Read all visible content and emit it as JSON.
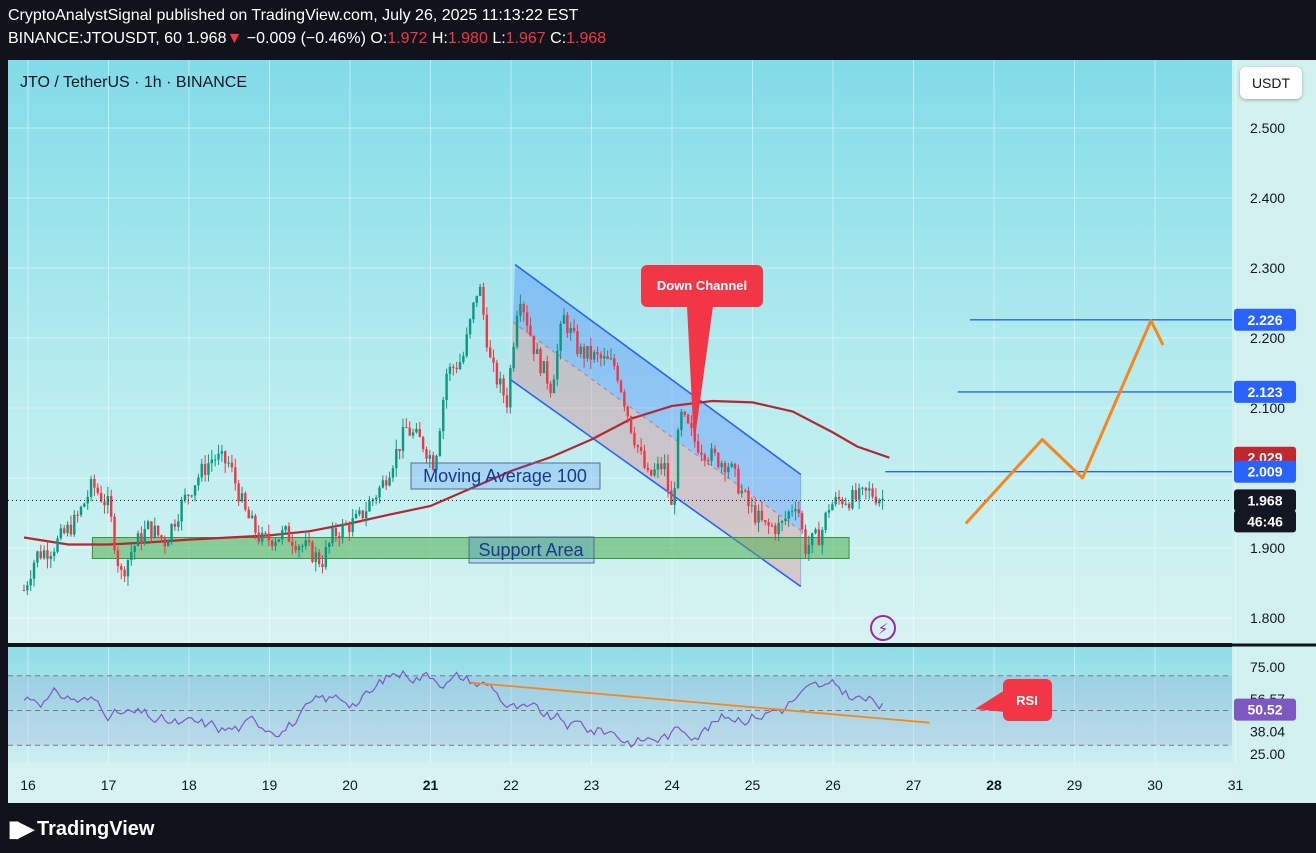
{
  "header": {
    "publisher_line": "CryptoAnalystSignal published on TradingView.com, July 26, 2025 11:13:22 EST",
    "symbol_line_prefix": "BINANCE:JTOUSDT, 60",
    "last": "1.968",
    "change": "−0.009 (−0.46%)",
    "open_label": "O:",
    "open": "1.972",
    "high_label": "H:",
    "high": "1.980",
    "low_label": "L:",
    "low": "1.967",
    "close_label": "C:",
    "close": "1.968"
  },
  "pane": {
    "symbol_title": "JTO / TetherUS · 1h · BINANCE",
    "currency_button": "USDT",
    "price_labels": [
      "2.500",
      "2.400",
      "2.300",
      "2.200",
      "2.100",
      "1.900",
      "1.800"
    ],
    "badges": [
      {
        "text": "2.226",
        "color": "#2962ff"
      },
      {
        "text": "2.123",
        "color": "#2962ff"
      },
      {
        "text": "2.029",
        "color": "#c2272d"
      },
      {
        "text": "2.009",
        "color": "#2962ff"
      },
      {
        "text": "1.968",
        "color": "#131722"
      },
      {
        "text": "46:46",
        "color": "#131722"
      }
    ],
    "annotations": {
      "down_channel": "Down Channel",
      "moving_average": "Moving Average 100",
      "support_area": "Support Area",
      "rsi_callout": "RSI"
    }
  },
  "rsi_pane": {
    "labels": [
      "75.00",
      "56.57",
      "38.04",
      "25.00"
    ],
    "value_badge": "50.52"
  },
  "x_axis": {
    "ticks": [
      "16",
      "17",
      "18",
      "19",
      "20",
      "21",
      "22",
      "23",
      "24",
      "25",
      "26",
      "27",
      "28",
      "29",
      "30",
      "31"
    ]
  },
  "footer": {
    "brand": "TradingView"
  },
  "chart_data": {
    "type": "candlestick",
    "title": "JTO / TetherUS · 1h · BINANCE",
    "x_ticks": [
      "16",
      "17",
      "18",
      "19",
      "20",
      "21",
      "22",
      "23",
      "24",
      "25",
      "26",
      "27",
      "28",
      "29",
      "30",
      "31"
    ],
    "ylim": [
      1.76,
      2.58
    ],
    "price_path": [
      {
        "x": 15.95,
        "y": 1.84
      },
      {
        "x": 16.1,
        "y": 1.89
      },
      {
        "x": 16.3,
        "y": 1.9
      },
      {
        "x": 16.6,
        "y": 1.94
      },
      {
        "x": 16.8,
        "y": 1.99
      },
      {
        "x": 17.0,
        "y": 1.96
      },
      {
        "x": 17.15,
        "y": 1.86
      },
      {
        "x": 17.3,
        "y": 1.9
      },
      {
        "x": 17.5,
        "y": 1.93
      },
      {
        "x": 17.7,
        "y": 1.91
      },
      {
        "x": 17.9,
        "y": 1.96
      },
      {
        "x": 18.1,
        "y": 2.0
      },
      {
        "x": 18.3,
        "y": 2.03
      },
      {
        "x": 18.5,
        "y": 2.02
      },
      {
        "x": 18.7,
        "y": 1.95
      },
      {
        "x": 18.9,
        "y": 1.91
      },
      {
        "x": 19.2,
        "y": 1.92
      },
      {
        "x": 19.45,
        "y": 1.9
      },
      {
        "x": 19.65,
        "y": 1.88
      },
      {
        "x": 19.8,
        "y": 1.92
      },
      {
        "x": 20.1,
        "y": 1.94
      },
      {
        "x": 20.4,
        "y": 1.99
      },
      {
        "x": 20.7,
        "y": 2.07
      },
      {
        "x": 20.9,
        "y": 2.05
      },
      {
        "x": 21.05,
        "y": 2.02
      },
      {
        "x": 21.2,
        "y": 2.15
      },
      {
        "x": 21.4,
        "y": 2.17
      },
      {
        "x": 21.6,
        "y": 2.28
      },
      {
        "x": 21.75,
        "y": 2.16
      },
      {
        "x": 21.95,
        "y": 2.11
      },
      {
        "x": 22.1,
        "y": 2.27
      },
      {
        "x": 22.3,
        "y": 2.18
      },
      {
        "x": 22.5,
        "y": 2.13
      },
      {
        "x": 22.65,
        "y": 2.23
      },
      {
        "x": 22.85,
        "y": 2.18
      },
      {
        "x": 23.1,
        "y": 2.17
      },
      {
        "x": 23.3,
        "y": 2.16
      },
      {
        "x": 23.5,
        "y": 2.07
      },
      {
        "x": 23.7,
        "y": 2.0
      },
      {
        "x": 23.9,
        "y": 2.02
      },
      {
        "x": 24.0,
        "y": 1.95
      },
      {
        "x": 24.1,
        "y": 2.09
      },
      {
        "x": 24.3,
        "y": 2.05
      },
      {
        "x": 24.5,
        "y": 2.03
      },
      {
        "x": 24.7,
        "y": 2.02
      },
      {
        "x": 24.95,
        "y": 1.96
      },
      {
        "x": 25.15,
        "y": 1.93
      },
      {
        "x": 25.35,
        "y": 1.93
      },
      {
        "x": 25.55,
        "y": 1.97
      },
      {
        "x": 25.65,
        "y": 1.9
      },
      {
        "x": 25.85,
        "y": 1.92
      },
      {
        "x": 25.95,
        "y": 1.96
      },
      {
        "x": 26.1,
        "y": 1.97
      },
      {
        "x": 26.3,
        "y": 1.97
      },
      {
        "x": 26.45,
        "y": 1.98
      },
      {
        "x": 26.65,
        "y": 1.968
      }
    ],
    "moving_average_100": [
      {
        "x": 15.95,
        "y": 1.915
      },
      {
        "x": 16.5,
        "y": 1.905
      },
      {
        "x": 17.0,
        "y": 1.905
      },
      {
        "x": 17.5,
        "y": 1.908
      },
      {
        "x": 18.0,
        "y": 1.912
      },
      {
        "x": 18.5,
        "y": 1.915
      },
      {
        "x": 19.0,
        "y": 1.918
      },
      {
        "x": 19.5,
        "y": 1.924
      },
      {
        "x": 20.0,
        "y": 1.935
      },
      {
        "x": 20.5,
        "y": 1.948
      },
      {
        "x": 21.0,
        "y": 1.96
      },
      {
        "x": 21.5,
        "y": 1.985
      },
      {
        "x": 22.0,
        "y": 2.01
      },
      {
        "x": 22.5,
        "y": 2.03
      },
      {
        "x": 23.0,
        "y": 2.055
      },
      {
        "x": 23.5,
        "y": 2.085
      },
      {
        "x": 24.0,
        "y": 2.103
      },
      {
        "x": 24.5,
        "y": 2.11
      },
      {
        "x": 25.0,
        "y": 2.108
      },
      {
        "x": 25.5,
        "y": 2.095
      },
      {
        "x": 26.0,
        "y": 2.065
      },
      {
        "x": 26.3,
        "y": 2.045
      },
      {
        "x": 26.7,
        "y": 2.029
      }
    ],
    "down_channel": {
      "upper": [
        {
          "x": 22.05,
          "y": 2.305
        },
        {
          "x": 25.6,
          "y": 2.005
        }
      ],
      "lower": [
        {
          "x": 22.0,
          "y": 2.14
        },
        {
          "x": 25.6,
          "y": 1.845
        }
      ]
    },
    "support_area": {
      "x_from": 16.8,
      "x_to": 26.2,
      "y_from": 1.885,
      "y_to": 1.915
    },
    "target_lines": [
      {
        "price": 2.226,
        "x_from": 27.7
      },
      {
        "price": 2.123,
        "x_from": 27.55
      },
      {
        "price": 2.009,
        "x_from": 26.65
      }
    ],
    "projection_path": [
      {
        "x": 27.65,
        "y": 1.935
      },
      {
        "x": 28.6,
        "y": 2.055
      },
      {
        "x": 29.1,
        "y": 2.0
      },
      {
        "x": 29.95,
        "y": 2.225
      },
      {
        "x": 30.1,
        "y": 2.19
      }
    ],
    "rsi": {
      "levels": [
        70,
        50,
        30
      ],
      "axis_labels": [
        75,
        56.57,
        38.04,
        25
      ],
      "current": 50.52,
      "trendline": [
        {
          "x": 21.5,
          "y": 66
        },
        {
          "x": 27.2,
          "y": 43
        }
      ]
    }
  }
}
